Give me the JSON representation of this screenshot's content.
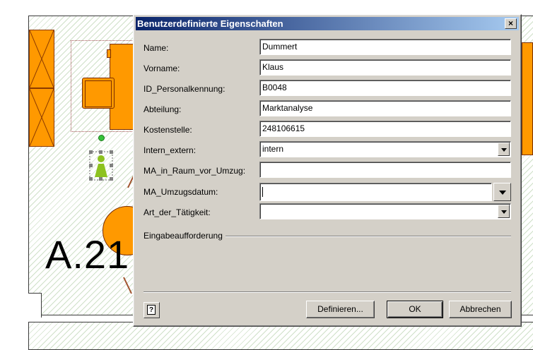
{
  "background": {
    "room_label": "A.21"
  },
  "dialog": {
    "title": "Benutzerdefinierte Eigenschaften",
    "close_label": "×",
    "fields": [
      {
        "label": "Name:",
        "value": "Dummert"
      },
      {
        "label": "Vorname:",
        "value": "Klaus"
      },
      {
        "label": "ID_Personalkennung:",
        "value": "B0048"
      },
      {
        "label": "Abteilung:",
        "value": "Marktanalyse"
      },
      {
        "label": "Kostenstelle:",
        "value": "248106615"
      },
      {
        "label": "Intern_extern:",
        "value": "intern"
      },
      {
        "label": "MA_in_Raum_vor_Umzug:",
        "value": ""
      },
      {
        "label": "MA_Umzugsdatum:",
        "value": ""
      },
      {
        "label": "Art_der_Tätigkeit:",
        "value": ""
      }
    ],
    "group_label": "Eingabeaufforderung",
    "buttons": {
      "define": "Definieren...",
      "ok": "OK",
      "cancel": "Abbrechen"
    },
    "help_icon": "?"
  },
  "colors": {
    "title_start": "#0a246a",
    "title_end": "#a6caf0",
    "dialog_bg": "#d4d0c8",
    "furniture": "#ff9900",
    "person": "#8dc21f"
  }
}
